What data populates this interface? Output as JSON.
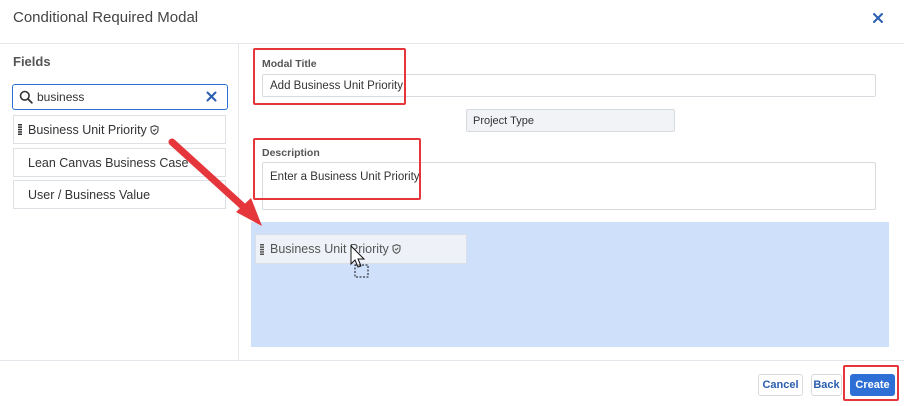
{
  "modal": {
    "title": "Conditional Required Modal"
  },
  "sidebar": {
    "title": "Fields",
    "search": {
      "value": "business",
      "placeholder": ""
    },
    "items": [
      {
        "label": "Business Unit Priority",
        "draggable": true,
        "required_icon": "shield-icon"
      },
      {
        "label": "Lean Canvas Business Case"
      },
      {
        "label": "User / Business Value"
      }
    ]
  },
  "form": {
    "modal_title_label": "Modal Title",
    "modal_title_value": "Add Business Unit Priority",
    "project_type": "Project Type",
    "description_label": "Description",
    "description_value": "Enter a Business Unit Priority.",
    "dragged_item_label": "Business Unit Priority"
  },
  "footer": {
    "cancel_label": "Cancel",
    "back_label": "Back",
    "create_label": "Create"
  },
  "colors": {
    "primary": "#2e6fd6",
    "annotation_red": "#e5373b",
    "drop_zone": "#cfe0fa"
  }
}
